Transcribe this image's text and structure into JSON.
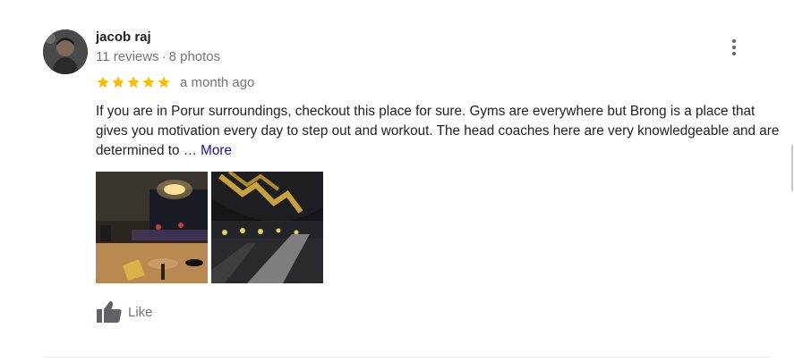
{
  "review": {
    "author_name": "jacob raj",
    "reviews_count": "11 reviews",
    "meta_separator": "·",
    "photos_count": "8 photos",
    "rating": 5,
    "date": "a month ago",
    "text": "If you are in Porur surroundings, checkout this place for sure. Gyms are everywhere but Brong is a place that gives you motivation every day to step out and workout. The head coaches here are very knowledgeable and are determined to …",
    "more_label": "More",
    "like_label": "Like",
    "star_color": "#fbbc04",
    "photos": [
      {
        "icon": "gym-interior-photo"
      },
      {
        "icon": "gym-floor-photo"
      }
    ]
  }
}
